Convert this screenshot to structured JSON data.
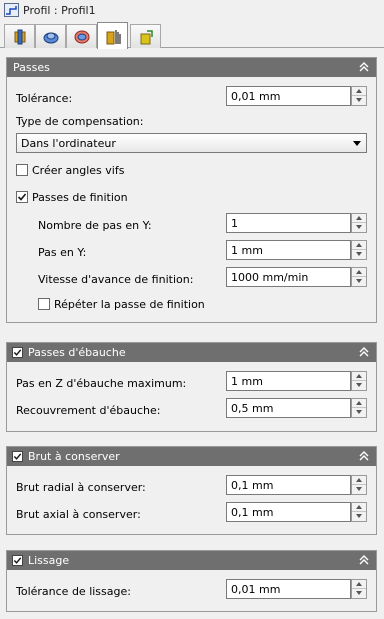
{
  "window": {
    "title": "Profil : Profil1"
  },
  "tabs": [
    {
      "icon": "tool-icon",
      "active": false
    },
    {
      "icon": "shape-icon",
      "active": false
    },
    {
      "icon": "heights-icon",
      "active": false
    },
    {
      "icon": "passes-icon",
      "active": true
    },
    {
      "icon": "linking-icon",
      "active": false
    }
  ],
  "passes": {
    "header": "Passes",
    "tolerance_label": "Tolérance:",
    "tolerance_value": "0,01 mm",
    "compensation_label": "Type de compensation:",
    "compensation_value": "Dans l'ordinateur",
    "sharp_corners_label": "Créer angles vifs",
    "sharp_corners_checked": false,
    "finishing_label": "Passes de finition",
    "finishing_checked": true,
    "num_steps_label": "Nombre de pas en Y:",
    "num_steps_value": "1",
    "stepover_label": "Pas en Y:",
    "stepover_value": "1 mm",
    "feedrate_label": "Vitesse d'avance de finition:",
    "feedrate_value": "1000 mm/min",
    "repeat_label": "Répéter la passe de finition",
    "repeat_checked": false
  },
  "roughing": {
    "header": "Passes d'ébauche",
    "checked": true,
    "max_stepdown_label": "Pas en Z d'ébauche maximum:",
    "max_stepdown_value": "1 mm",
    "overlap_label": "Recouvrement d'ébauche:",
    "overlap_value": "0,5 mm"
  },
  "stock": {
    "header": "Brut à conserver",
    "checked": true,
    "radial_label": "Brut radial à conserver:",
    "radial_value": "0,1 mm",
    "axial_label": "Brut axial à conserver:",
    "axial_value": "0,1 mm"
  },
  "smoothing": {
    "header": "Lissage",
    "checked": true,
    "tolerance_label": "Tolérance de lissage:",
    "tolerance_value": "0,01 mm"
  }
}
